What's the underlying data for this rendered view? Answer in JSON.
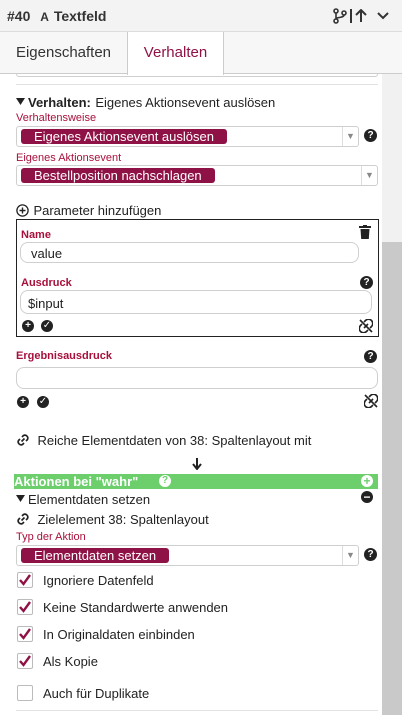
{
  "titlebar": {
    "id": "#40",
    "type_icon_text": "A",
    "title": "Textfeld"
  },
  "tabs": [
    {
      "label": "Eigenschaften"
    },
    {
      "label": "Verhalten"
    }
  ],
  "section": {
    "prefix": "Verhalten:",
    "title": "Eigenes Aktionsevent auslösen"
  },
  "verhaltensweise": {
    "label": "Verhaltensweise",
    "value": "Eigenes Aktionsevent auslösen"
  },
  "aktionsevent": {
    "label": "Eigenes Aktionsevent",
    "value": "Bestellposition nachschlagen"
  },
  "parameter": {
    "add_label": "Parameter hinzufügen",
    "name_label": "Name",
    "name_value": "value",
    "ausdruck_label": "Ausdruck",
    "ausdruck_value": "$input"
  },
  "ergebnis": {
    "label": "Ergebnisausdruck",
    "value": ""
  },
  "reiche": {
    "text": "Reiche Elementdaten von 38: Spaltenlayout mit"
  },
  "aktionen": {
    "label": "Aktionen bei \"wahr\""
  },
  "elementdaten": {
    "title": "Elementdaten setzen"
  },
  "ziel": {
    "text": "Zielelement 38: Spaltenlayout"
  },
  "typ": {
    "label": "Typ der Aktion",
    "value": "Elementdaten setzen"
  },
  "checkboxes": [
    {
      "label": "Ignoriere Datenfeld",
      "checked": true
    },
    {
      "label": "Keine Standardwerte anwenden",
      "checked": true
    },
    {
      "label": "In Originaldaten einbinden",
      "checked": true
    },
    {
      "label": "Als Kopie",
      "checked": true
    },
    {
      "label": "Auch für Duplikate",
      "checked": false
    }
  ],
  "colors": {
    "accent": "#8e1245",
    "label": "#a8103c",
    "green_bar": "#6ccf6c"
  },
  "icons": {
    "toolbar": [
      "branch-icon",
      "up-arrow-icon",
      "chevron-down-icon"
    ],
    "help": "question-icon",
    "add": "plus-circle-icon",
    "confirm": "check-circle-icon",
    "delete": "trash-icon",
    "unlink": "unlink-icon",
    "link": "link-icon",
    "down": "arrow-down-icon",
    "collapse": "minus-circle-icon"
  }
}
